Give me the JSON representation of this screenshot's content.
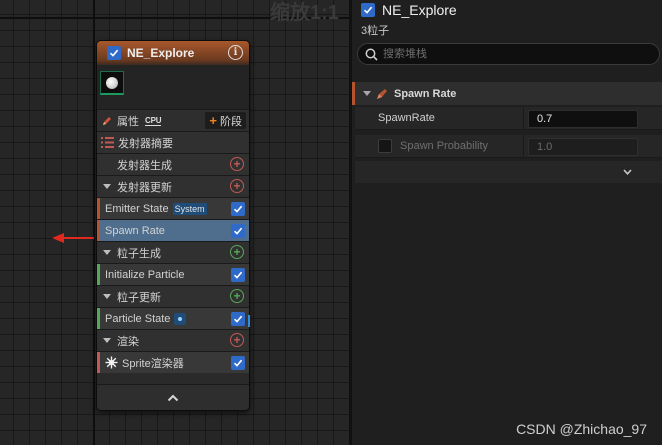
{
  "graph": {
    "zoom_label": "缩放1:1"
  },
  "node": {
    "title": "NE_Explore",
    "enabled": true,
    "properties_label": "属性",
    "cpu_label": "CPU",
    "stage_button_label": "阶段",
    "sections": [
      {
        "label": "发射器摘要"
      },
      {
        "label": "发射器生成"
      },
      {
        "label": "发射器更新"
      },
      {
        "label": "Emitter State",
        "badge": "System"
      },
      {
        "label": "Spawn Rate"
      },
      {
        "label": "粒子生成"
      },
      {
        "label": "Initialize Particle"
      },
      {
        "label": "粒子更新"
      },
      {
        "label": "Particle State"
      },
      {
        "label": "渲染"
      },
      {
        "label": "Sprite渲染器"
      }
    ],
    "stage_colors": {
      "emitter": "#b5532f",
      "particle": "#57a75a",
      "render": "#c05a55",
      "selected": "#4f6e8e"
    }
  },
  "details": {
    "title": "NE_Explore",
    "subtitle": "3粒子",
    "search_placeholder": "搜索堆栈",
    "category": "Spawn Rate",
    "properties": [
      {
        "name": "SpawnRate",
        "value": "0.7",
        "enabled": true
      },
      {
        "name": "Spawn Probability",
        "value": "1.0",
        "enabled": false
      }
    ]
  },
  "watermark": "CSDN @Zhichao_97"
}
